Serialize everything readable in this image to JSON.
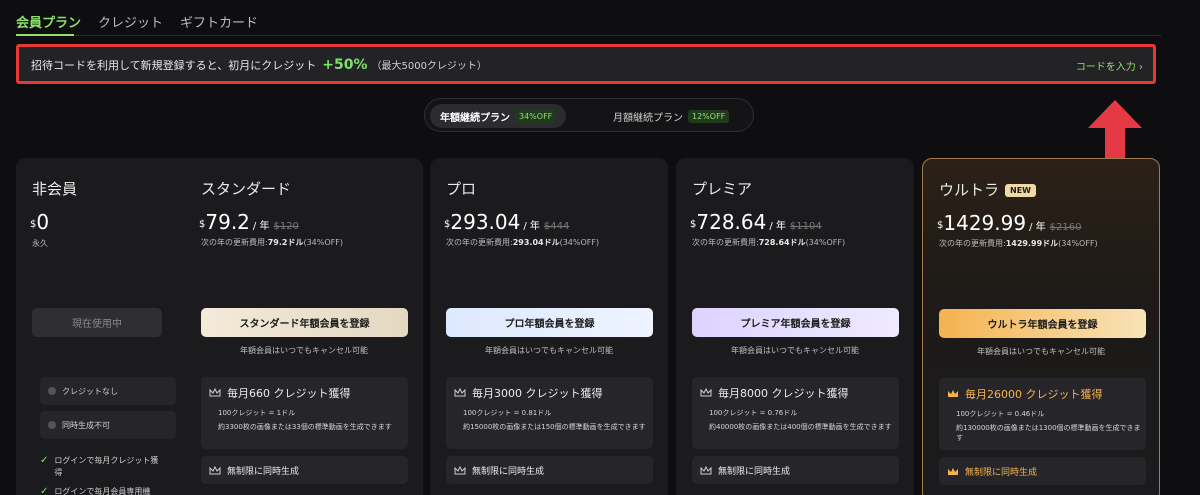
{
  "tabs": [
    {
      "label": "会員プラン",
      "active": true
    },
    {
      "label": "クレジット",
      "active": false
    },
    {
      "label": "ギフトカード",
      "active": false
    }
  ],
  "banner": {
    "text": "招待コードを利用して新規登録すると、初月にクレジット",
    "percent": "+50%",
    "note": "（最大5000クレジット）",
    "link": "コードを入力 ›"
  },
  "billing": {
    "yearly_label": "年額継続プラン",
    "yearly_badge": "34%OFF",
    "monthly_label": "月額継続プラン",
    "monthly_badge": "12%OFF"
  },
  "plans": [
    {
      "name": "非会員",
      "currency": "$",
      "price": "0",
      "sub": "永久",
      "cta": "現在使用中",
      "features": [
        "クレジットなし",
        "同時生成不可"
      ],
      "checks": [
        "ログインで毎月クレジット獲得",
        "ログインで毎月会員専用機"
      ]
    },
    {
      "name": "スタンダード",
      "currency": "$",
      "price": "79.2",
      "per": "/ 年",
      "orig": "$120",
      "renew_prefix": "次の年の更新費用:",
      "renew_value": "79.2ドル",
      "renew_suffix": "(34%OFF)",
      "cta": "スタンダード年額会員を登録",
      "cancel": "年額会員はいつでもキャンセル可能",
      "credits": "毎月660 クレジット獲得",
      "rate": "100クレジット = 1ドル",
      "desc": "約3300枚の画像または33個の標準動画を生成できます",
      "concurrent": "無制限に同時生成"
    },
    {
      "name": "プロ",
      "currency": "$",
      "price": "293.04",
      "per": "/ 年",
      "orig": "$444",
      "renew_prefix": "次の年の更新費用:",
      "renew_value": "293.04ドル",
      "renew_suffix": "(34%OFF)",
      "cta": "プロ年額会員を登録",
      "cancel": "年額会員はいつでもキャンセル可能",
      "credits": "毎月3000 クレジット獲得",
      "rate": "100クレジット = 0.81ドル",
      "desc": "約15000枚の画像または150個の標準動画を生成できます",
      "concurrent": "無制限に同時生成"
    },
    {
      "name": "プレミア",
      "currency": "$",
      "price": "728.64",
      "per": "/ 年",
      "orig": "$1104",
      "renew_prefix": "次の年の更新費用:",
      "renew_value": "728.64ドル",
      "renew_suffix": "(34%OFF)",
      "cta": "プレミア年額会員を登録",
      "cancel": "年額会員はいつでもキャンセル可能",
      "credits": "毎月8000 クレジット獲得",
      "rate": "100クレジット = 0.76ドル",
      "desc": "約40000枚の画像または400個の標準動画を生成できます",
      "concurrent": "無制限に同時生成"
    },
    {
      "name": "ウルトラ",
      "badge": "NEW",
      "currency": "$",
      "price": "1429.99",
      "per": "/ 年",
      "orig": "$2160",
      "renew_prefix": "次の年の更新費用:",
      "renew_value": "1429.99ドル",
      "renew_suffix": "(34%OFF)",
      "cta": "ウルトラ年額会員を登録",
      "cancel": "年額会員はいつでもキャンセル可能",
      "credits": "毎月26000 クレジット獲得",
      "rate": "100クレジット = 0.46ドル",
      "desc": "約130000枚の画像または1300個の標準動画を生成できます",
      "concurrent": "無制限に同時生成"
    }
  ],
  "colors": {
    "accent": "#8ee06a",
    "highlight_border": "#e53935",
    "arrow": "#e53945",
    "gold": "#f5b24f"
  }
}
